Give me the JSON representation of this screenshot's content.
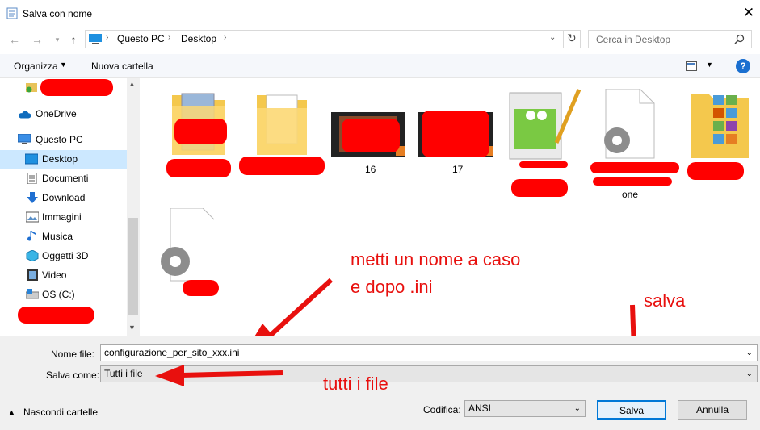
{
  "window": {
    "title": "Salva con nome"
  },
  "address": {
    "crumbs": [
      "Questo PC",
      "Desktop"
    ]
  },
  "search": {
    "placeholder": "Cerca in Desktop"
  },
  "toolbar": {
    "organize": "Organizza",
    "new_folder": "Nuova cartella"
  },
  "sidebar": {
    "items": [
      {
        "label": "OneDrive"
      },
      {
        "label": "Questo PC"
      },
      {
        "label": "Desktop"
      },
      {
        "label": "Documenti"
      },
      {
        "label": "Download"
      },
      {
        "label": "Immagini"
      },
      {
        "label": "Musica"
      },
      {
        "label": "Oggetti 3D"
      },
      {
        "label": "Video"
      },
      {
        "label": "OS (C:)"
      }
    ]
  },
  "files": [
    {
      "label": "16"
    },
    {
      "label": "17"
    },
    {
      "label": "one"
    }
  ],
  "form": {
    "filename_label": "Nome file:",
    "filename_value": "configurazione_per_sito_xxx.ini",
    "savetype_label": "Salva come:",
    "savetype_value": "Tutti i file",
    "encoding_label": "Codifica:",
    "encoding_value": "ANSI"
  },
  "buttons": {
    "hide_folders": "Nascondi cartelle",
    "save": "Salva",
    "cancel": "Annulla"
  },
  "annotations": {
    "name_hint_1": "metti un nome a caso",
    "name_hint_2": "e dopo .ini",
    "save_hint": "salva",
    "type_hint": "tutti i file"
  },
  "colors": {
    "accent": "#0078d7",
    "selected": "#cce8ff",
    "annotation": "#e8100e"
  }
}
